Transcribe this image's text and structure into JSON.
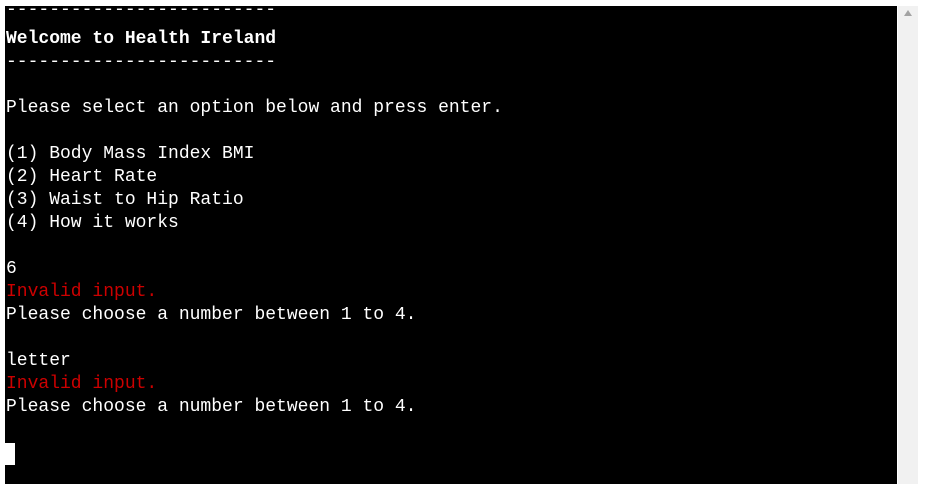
{
  "terminal": {
    "rule_top": "-------------------------",
    "title": "Welcome to Health Ireland",
    "rule_bottom": "-------------------------",
    "prompt": "Please select an option below and press enter.",
    "options": [
      "(1) Body Mass Index BMI",
      "(2) Heart Rate",
      "(3) Waist to Hip Ratio",
      "(4) How it works"
    ],
    "attempts": [
      {
        "input": "6",
        "error": "Invalid input.",
        "message": "Please choose a number between 1 to 4."
      },
      {
        "input": "letter",
        "error": "Invalid input.",
        "message": "Please choose a number between 1 to 4."
      }
    ]
  },
  "colors": {
    "background": "#000000",
    "text": "#ffffff",
    "error": "#cc0000"
  },
  "scrollbar": {
    "up_icon": "triangle-up-icon"
  }
}
